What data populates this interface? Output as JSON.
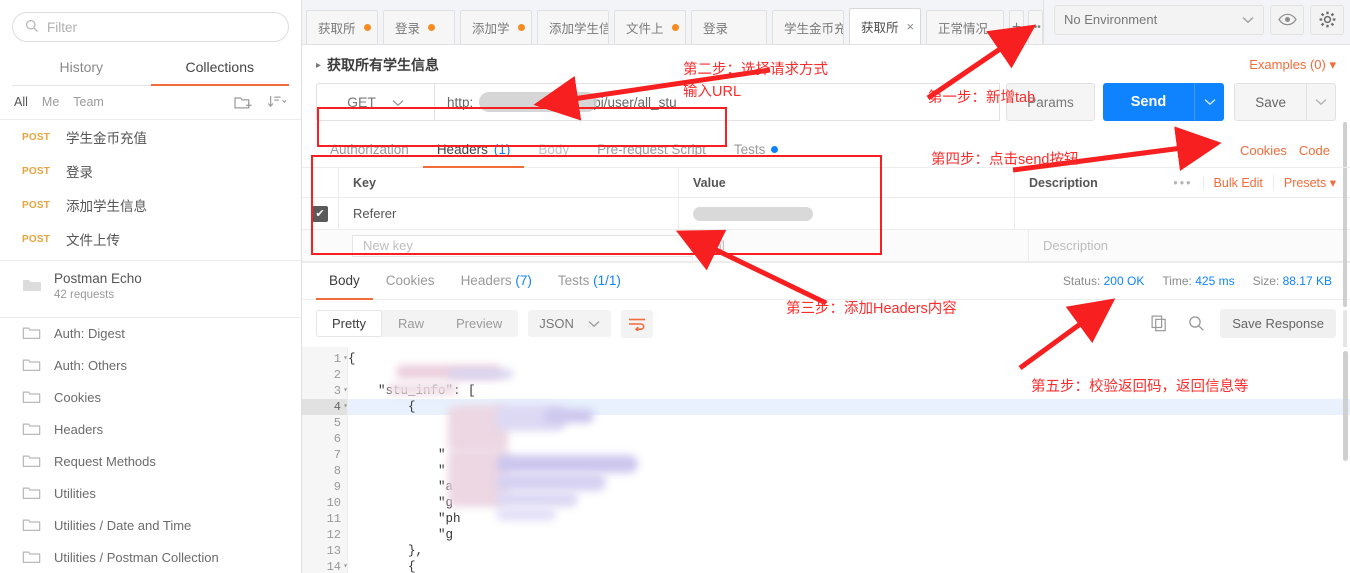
{
  "sidebar": {
    "search": {
      "placeholder": "Filter",
      "icon": "search-icon"
    },
    "tabs": [
      {
        "label": "History",
        "active": false
      },
      {
        "label": "Collections",
        "active": true
      }
    ],
    "scope": [
      {
        "label": "All",
        "active": true
      },
      {
        "label": "Me",
        "active": false
      },
      {
        "label": "Team",
        "active": false
      }
    ],
    "new_folder_icon": "new-folder-icon",
    "sort_icon": "sort-icon",
    "requests": [
      {
        "method": "POST",
        "name": "学生金币充值"
      },
      {
        "method": "POST",
        "name": "登录"
      },
      {
        "method": "POST",
        "name": "添加学生信息"
      },
      {
        "method": "POST",
        "name": "文件上传"
      }
    ],
    "collection": {
      "name": "Postman Echo",
      "meta": "42 requests",
      "icon": "folder-icon"
    },
    "folders": [
      {
        "label": "Auth: Digest"
      },
      {
        "label": "Auth: Others"
      },
      {
        "label": "Cookies"
      },
      {
        "label": "Headers"
      },
      {
        "label": "Request Methods"
      },
      {
        "label": "Utilities"
      },
      {
        "label": "Utilities / Date and Time"
      },
      {
        "label": "Utilities / Postman Collection"
      }
    ]
  },
  "tabbar": {
    "tabs": [
      {
        "label": "获取所",
        "dirty": true,
        "active": false
      },
      {
        "label": "登录",
        "dirty": true,
        "active": false
      },
      {
        "label": "添加学",
        "dirty": true,
        "active": false
      },
      {
        "label": "添加学生信息",
        "dirty": false,
        "active": false
      },
      {
        "label": "文件上",
        "dirty": true,
        "active": false
      },
      {
        "label": "登录",
        "dirty": false,
        "active": false
      },
      {
        "label": "学生金币充值",
        "dirty": false,
        "active": false
      },
      {
        "label": "获取所",
        "dirty": false,
        "active": true,
        "close": "×"
      },
      {
        "label": "正常情况",
        "dirty": false,
        "active": false
      }
    ],
    "new_tab": "+",
    "more": "•••",
    "environment": {
      "value": "No Environment",
      "caret": "chevron-down-icon"
    },
    "eye_icon": "eye-icon",
    "settings_icon": "gear-icon"
  },
  "request": {
    "title": "获取所有学生信息",
    "caret": "▸",
    "examples": "Examples (0)",
    "method": "GET",
    "url_prefix": "http:",
    "url_suffix": "pi/user/all_stu",
    "params_label": "Params",
    "send_label": "Send",
    "save_label": "Save",
    "tabs": [
      {
        "label": "Authorization",
        "active": false
      },
      {
        "label": "Headers",
        "count": "(1)",
        "active": true
      },
      {
        "label": "Body",
        "active": false,
        "muted": true
      },
      {
        "label": "Pre-request Script",
        "active": false
      },
      {
        "label": "Tests",
        "active": false,
        "dot": true
      }
    ],
    "links": [
      {
        "label": "Cookies"
      },
      {
        "label": "Code"
      }
    ],
    "table": {
      "columns": [
        "Key",
        "Value",
        "Description"
      ],
      "tools": {
        "ellipsis": "•••",
        "bulk_edit": "Bulk Edit",
        "presets": "Presets ▾"
      },
      "rows": [
        {
          "checked": true,
          "key": "Referer",
          "value": "",
          "description": ""
        }
      ],
      "new_row": {
        "key_placeholder": "New key",
        "value_placeholder": "Val",
        "desc_placeholder": "Description"
      }
    }
  },
  "response": {
    "tabs": [
      {
        "label": "Body",
        "active": true
      },
      {
        "label": "Cookies",
        "active": false
      },
      {
        "label": "Headers",
        "count": "(7)",
        "active": false
      },
      {
        "label": "Tests",
        "count": "(1/1)",
        "active": false
      }
    ],
    "status_label": "Status:",
    "status_value": "200 OK",
    "time_label": "Time:",
    "time_value": "425 ms",
    "size_label": "Size:",
    "size_value": "88.17 KB",
    "view_modes": [
      {
        "label": "Pretty",
        "active": true
      },
      {
        "label": "Raw",
        "active": false
      },
      {
        "label": "Preview",
        "active": false
      }
    ],
    "format": "JSON",
    "wrap_icon": "word-wrap-icon",
    "copy_icon": "copy-icon",
    "search_icon": "search-icon",
    "save_response": "Save Response",
    "body_lines": [
      {
        "n": "1",
        "fold": true,
        "text": "{"
      },
      {
        "n": "2",
        "fold": false,
        "text": ""
      },
      {
        "n": "3",
        "fold": true,
        "text": "    \"stu_info\": ["
      },
      {
        "n": "4",
        "fold": true,
        "text": "        {",
        "current": true
      },
      {
        "n": "5",
        "fold": false,
        "text": ""
      },
      {
        "n": "6",
        "fold": false,
        "text": ""
      },
      {
        "n": "7",
        "fold": false,
        "text": "            \""
      },
      {
        "n": "8",
        "fold": false,
        "text": "            \""
      },
      {
        "n": "9",
        "fold": false,
        "text": "            \"a"
      },
      {
        "n": "10",
        "fold": false,
        "text": "            \"g"
      },
      {
        "n": "11",
        "fold": false,
        "text": "            \"ph"
      },
      {
        "n": "12",
        "fold": false,
        "text": "            \"g"
      },
      {
        "n": "13",
        "fold": false,
        "text": "        },"
      },
      {
        "n": "14",
        "fold": true,
        "text": "        {"
      }
    ]
  },
  "annotations": [
    {
      "id": "step1",
      "text": "第一步：新增tab"
    },
    {
      "id": "step2",
      "text": "第二步：选择请求方式\n输入URL"
    },
    {
      "id": "step3",
      "text": "第三步：添加Headers内容"
    },
    {
      "id": "step4",
      "text": "第四步：点击send按钮"
    },
    {
      "id": "step5",
      "text": "第五步：校验返回码，返回信息等"
    }
  ],
  "colors": {
    "accent_orange": "#f26b3a",
    "send_blue": "#0f83fd",
    "annotation_red": "#fb2c2c",
    "method_post": "#e8a33d"
  }
}
